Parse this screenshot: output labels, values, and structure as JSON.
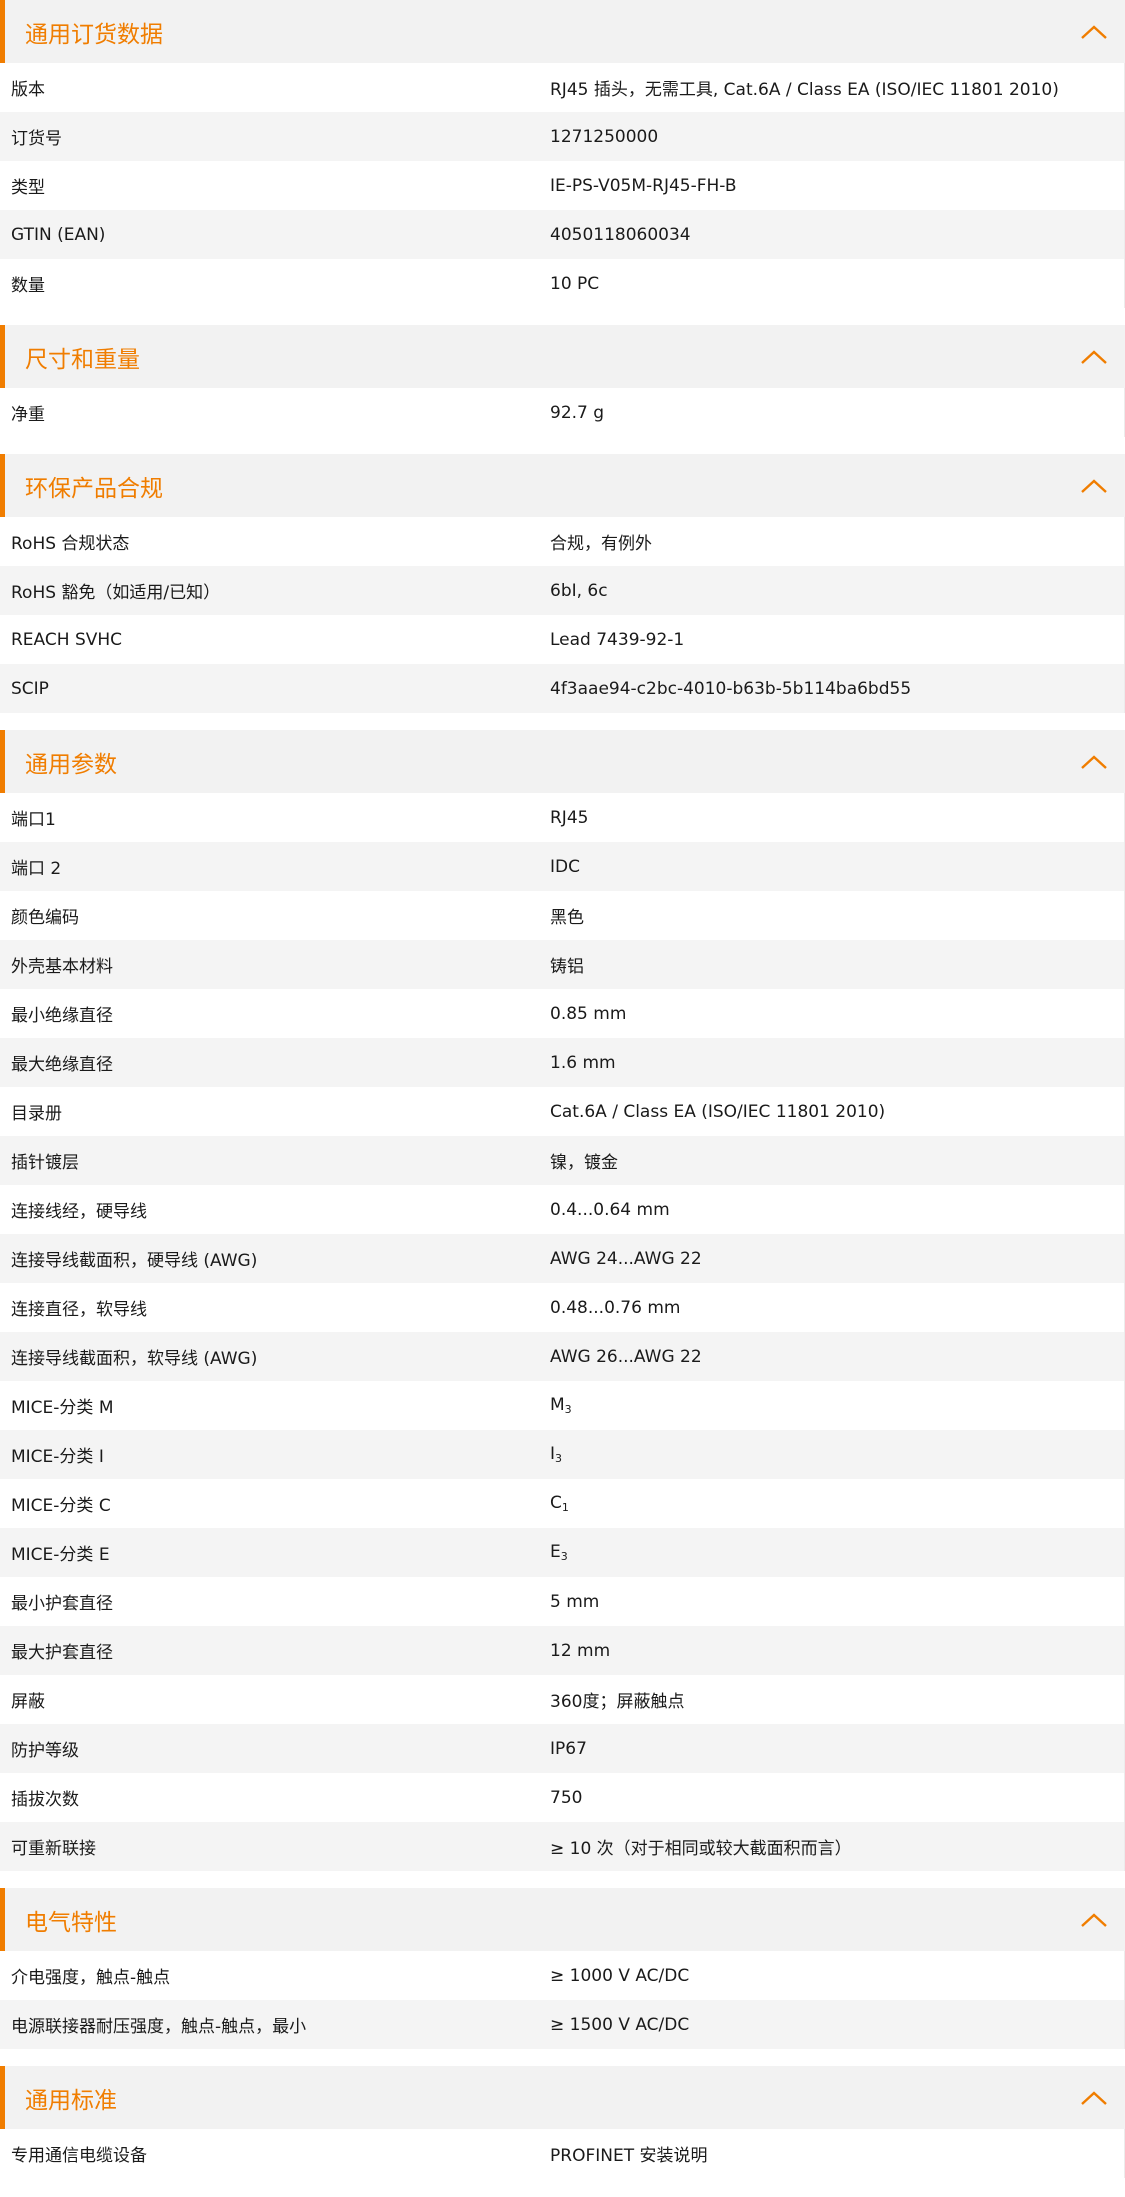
{
  "colors": {
    "accent": "#f07d00",
    "header_bg": "#f2f2f2",
    "row_alt_bg": "#f4f4f4"
  },
  "sections": [
    {
      "title": "通用订货数据",
      "rows": [
        {
          "label": "版本",
          "value": "RJ45 插头，无需工具, Cat.6A / Class EA (ISO/IEC 11801 2010)"
        },
        {
          "label": "订货号",
          "value": "1271250000"
        },
        {
          "label": "类型",
          "value": "IE-PS-V05M-RJ45-FH-B"
        },
        {
          "label": "GTIN (EAN)",
          "value": "4050118060034"
        },
        {
          "label": "数量",
          "value": "10  PC"
        }
      ]
    },
    {
      "title": "尺寸和重量",
      "rows": [
        {
          "label": "净重",
          "value": "92.7  g"
        }
      ]
    },
    {
      "title": "环保产品合规",
      "rows": [
        {
          "label": "RoHS 合规状态",
          "value": "合规，有例外"
        },
        {
          "label": "RoHS 豁免（如适用/已知）",
          "value": "6bI, 6c"
        },
        {
          "label": "REACH SVHC",
          "value": "Lead 7439-92-1"
        },
        {
          "label": "SCIP",
          "value": "4f3aae94-c2bc-4010-b63b-5b114ba6bd55"
        }
      ]
    },
    {
      "title": "通用参数",
      "rows": [
        {
          "label": "端口1",
          "value": "RJ45"
        },
        {
          "label": "端口 2",
          "value": "IDC"
        },
        {
          "label": "颜色编码",
          "value": "黑色"
        },
        {
          "label": "外壳基本材料",
          "value": "铸铝"
        },
        {
          "label": "最小绝缘直径",
          "value": "0.85  mm"
        },
        {
          "label": "最大绝缘直径",
          "value": "1.6  mm"
        },
        {
          "label": "目录册",
          "value": "Cat.6A / Class EA (ISO/IEC 11801 2010)"
        },
        {
          "label": "插针镀层",
          "value": "镍，镀金"
        },
        {
          "label": "连接线经，硬导线",
          "value": "0.4...0.64 mm"
        },
        {
          "label": "连接导线截面积，硬导线 (AWG)",
          "value": "AWG 24...AWG 22"
        },
        {
          "label": "连接直径，软导线",
          "value": "0.48...0.76 mm"
        },
        {
          "label": "连接导线截面积，软导线 (AWG)",
          "value": "AWG 26...AWG 22"
        },
        {
          "label": "MICE-分类 M",
          "value": "M",
          "sub": "3"
        },
        {
          "label": "MICE-分类 I",
          "value": "I",
          "sub": "3"
        },
        {
          "label": "MICE-分类 C",
          "value": "C",
          "sub": "1"
        },
        {
          "label": "MICE-分类 E",
          "value": "E",
          "sub": "3"
        },
        {
          "label": "最小护套直径",
          "value": "5  mm"
        },
        {
          "label": "最大护套直径",
          "value": "12  mm"
        },
        {
          "label": "屏蔽",
          "value": "360度；屏蔽触点"
        },
        {
          "label": "防护等级",
          "value": "IP67"
        },
        {
          "label": "插拔次数",
          "value": "750"
        },
        {
          "label": "可重新联接",
          "value": "≥ 10 次（对于相同或较大截面积而言）"
        }
      ]
    },
    {
      "title": "电气特性",
      "rows": [
        {
          "label": "介电强度，触点-触点",
          "value": "≥ 1000 V AC/DC"
        },
        {
          "label": "电源联接器耐压强度，触点-触点，最小",
          "value": "≥ 1500 V AC/DC"
        }
      ]
    },
    {
      "title": "通用标准",
      "rows": [
        {
          "label": "专用通信电缆设备",
          "value": "PROFINET 安装说明"
        }
      ]
    }
  ]
}
